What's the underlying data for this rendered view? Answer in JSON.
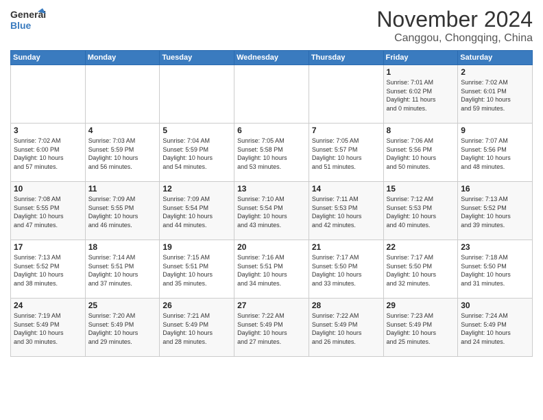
{
  "header": {
    "logo_general": "General",
    "logo_blue": "Blue",
    "month": "November 2024",
    "location": "Canggou, Chongqing, China"
  },
  "weekdays": [
    "Sunday",
    "Monday",
    "Tuesday",
    "Wednesday",
    "Thursday",
    "Friday",
    "Saturday"
  ],
  "weeks": [
    [
      {
        "day": "",
        "info": ""
      },
      {
        "day": "",
        "info": ""
      },
      {
        "day": "",
        "info": ""
      },
      {
        "day": "",
        "info": ""
      },
      {
        "day": "",
        "info": ""
      },
      {
        "day": "1",
        "info": "Sunrise: 7:01 AM\nSunset: 6:02 PM\nDaylight: 11 hours\nand 0 minutes."
      },
      {
        "day": "2",
        "info": "Sunrise: 7:02 AM\nSunset: 6:01 PM\nDaylight: 10 hours\nand 59 minutes."
      }
    ],
    [
      {
        "day": "3",
        "info": "Sunrise: 7:02 AM\nSunset: 6:00 PM\nDaylight: 10 hours\nand 57 minutes."
      },
      {
        "day": "4",
        "info": "Sunrise: 7:03 AM\nSunset: 5:59 PM\nDaylight: 10 hours\nand 56 minutes."
      },
      {
        "day": "5",
        "info": "Sunrise: 7:04 AM\nSunset: 5:59 PM\nDaylight: 10 hours\nand 54 minutes."
      },
      {
        "day": "6",
        "info": "Sunrise: 7:05 AM\nSunset: 5:58 PM\nDaylight: 10 hours\nand 53 minutes."
      },
      {
        "day": "7",
        "info": "Sunrise: 7:05 AM\nSunset: 5:57 PM\nDaylight: 10 hours\nand 51 minutes."
      },
      {
        "day": "8",
        "info": "Sunrise: 7:06 AM\nSunset: 5:56 PM\nDaylight: 10 hours\nand 50 minutes."
      },
      {
        "day": "9",
        "info": "Sunrise: 7:07 AM\nSunset: 5:56 PM\nDaylight: 10 hours\nand 48 minutes."
      }
    ],
    [
      {
        "day": "10",
        "info": "Sunrise: 7:08 AM\nSunset: 5:55 PM\nDaylight: 10 hours\nand 47 minutes."
      },
      {
        "day": "11",
        "info": "Sunrise: 7:09 AM\nSunset: 5:55 PM\nDaylight: 10 hours\nand 46 minutes."
      },
      {
        "day": "12",
        "info": "Sunrise: 7:09 AM\nSunset: 5:54 PM\nDaylight: 10 hours\nand 44 minutes."
      },
      {
        "day": "13",
        "info": "Sunrise: 7:10 AM\nSunset: 5:54 PM\nDaylight: 10 hours\nand 43 minutes."
      },
      {
        "day": "14",
        "info": "Sunrise: 7:11 AM\nSunset: 5:53 PM\nDaylight: 10 hours\nand 42 minutes."
      },
      {
        "day": "15",
        "info": "Sunrise: 7:12 AM\nSunset: 5:53 PM\nDaylight: 10 hours\nand 40 minutes."
      },
      {
        "day": "16",
        "info": "Sunrise: 7:13 AM\nSunset: 5:52 PM\nDaylight: 10 hours\nand 39 minutes."
      }
    ],
    [
      {
        "day": "17",
        "info": "Sunrise: 7:13 AM\nSunset: 5:52 PM\nDaylight: 10 hours\nand 38 minutes."
      },
      {
        "day": "18",
        "info": "Sunrise: 7:14 AM\nSunset: 5:51 PM\nDaylight: 10 hours\nand 37 minutes."
      },
      {
        "day": "19",
        "info": "Sunrise: 7:15 AM\nSunset: 5:51 PM\nDaylight: 10 hours\nand 35 minutes."
      },
      {
        "day": "20",
        "info": "Sunrise: 7:16 AM\nSunset: 5:51 PM\nDaylight: 10 hours\nand 34 minutes."
      },
      {
        "day": "21",
        "info": "Sunrise: 7:17 AM\nSunset: 5:50 PM\nDaylight: 10 hours\nand 33 minutes."
      },
      {
        "day": "22",
        "info": "Sunrise: 7:17 AM\nSunset: 5:50 PM\nDaylight: 10 hours\nand 32 minutes."
      },
      {
        "day": "23",
        "info": "Sunrise: 7:18 AM\nSunset: 5:50 PM\nDaylight: 10 hours\nand 31 minutes."
      }
    ],
    [
      {
        "day": "24",
        "info": "Sunrise: 7:19 AM\nSunset: 5:49 PM\nDaylight: 10 hours\nand 30 minutes."
      },
      {
        "day": "25",
        "info": "Sunrise: 7:20 AM\nSunset: 5:49 PM\nDaylight: 10 hours\nand 29 minutes."
      },
      {
        "day": "26",
        "info": "Sunrise: 7:21 AM\nSunset: 5:49 PM\nDaylight: 10 hours\nand 28 minutes."
      },
      {
        "day": "27",
        "info": "Sunrise: 7:22 AM\nSunset: 5:49 PM\nDaylight: 10 hours\nand 27 minutes."
      },
      {
        "day": "28",
        "info": "Sunrise: 7:22 AM\nSunset: 5:49 PM\nDaylight: 10 hours\nand 26 minutes."
      },
      {
        "day": "29",
        "info": "Sunrise: 7:23 AM\nSunset: 5:49 PM\nDaylight: 10 hours\nand 25 minutes."
      },
      {
        "day": "30",
        "info": "Sunrise: 7:24 AM\nSunset: 5:49 PM\nDaylight: 10 hours\nand 24 minutes."
      }
    ]
  ]
}
